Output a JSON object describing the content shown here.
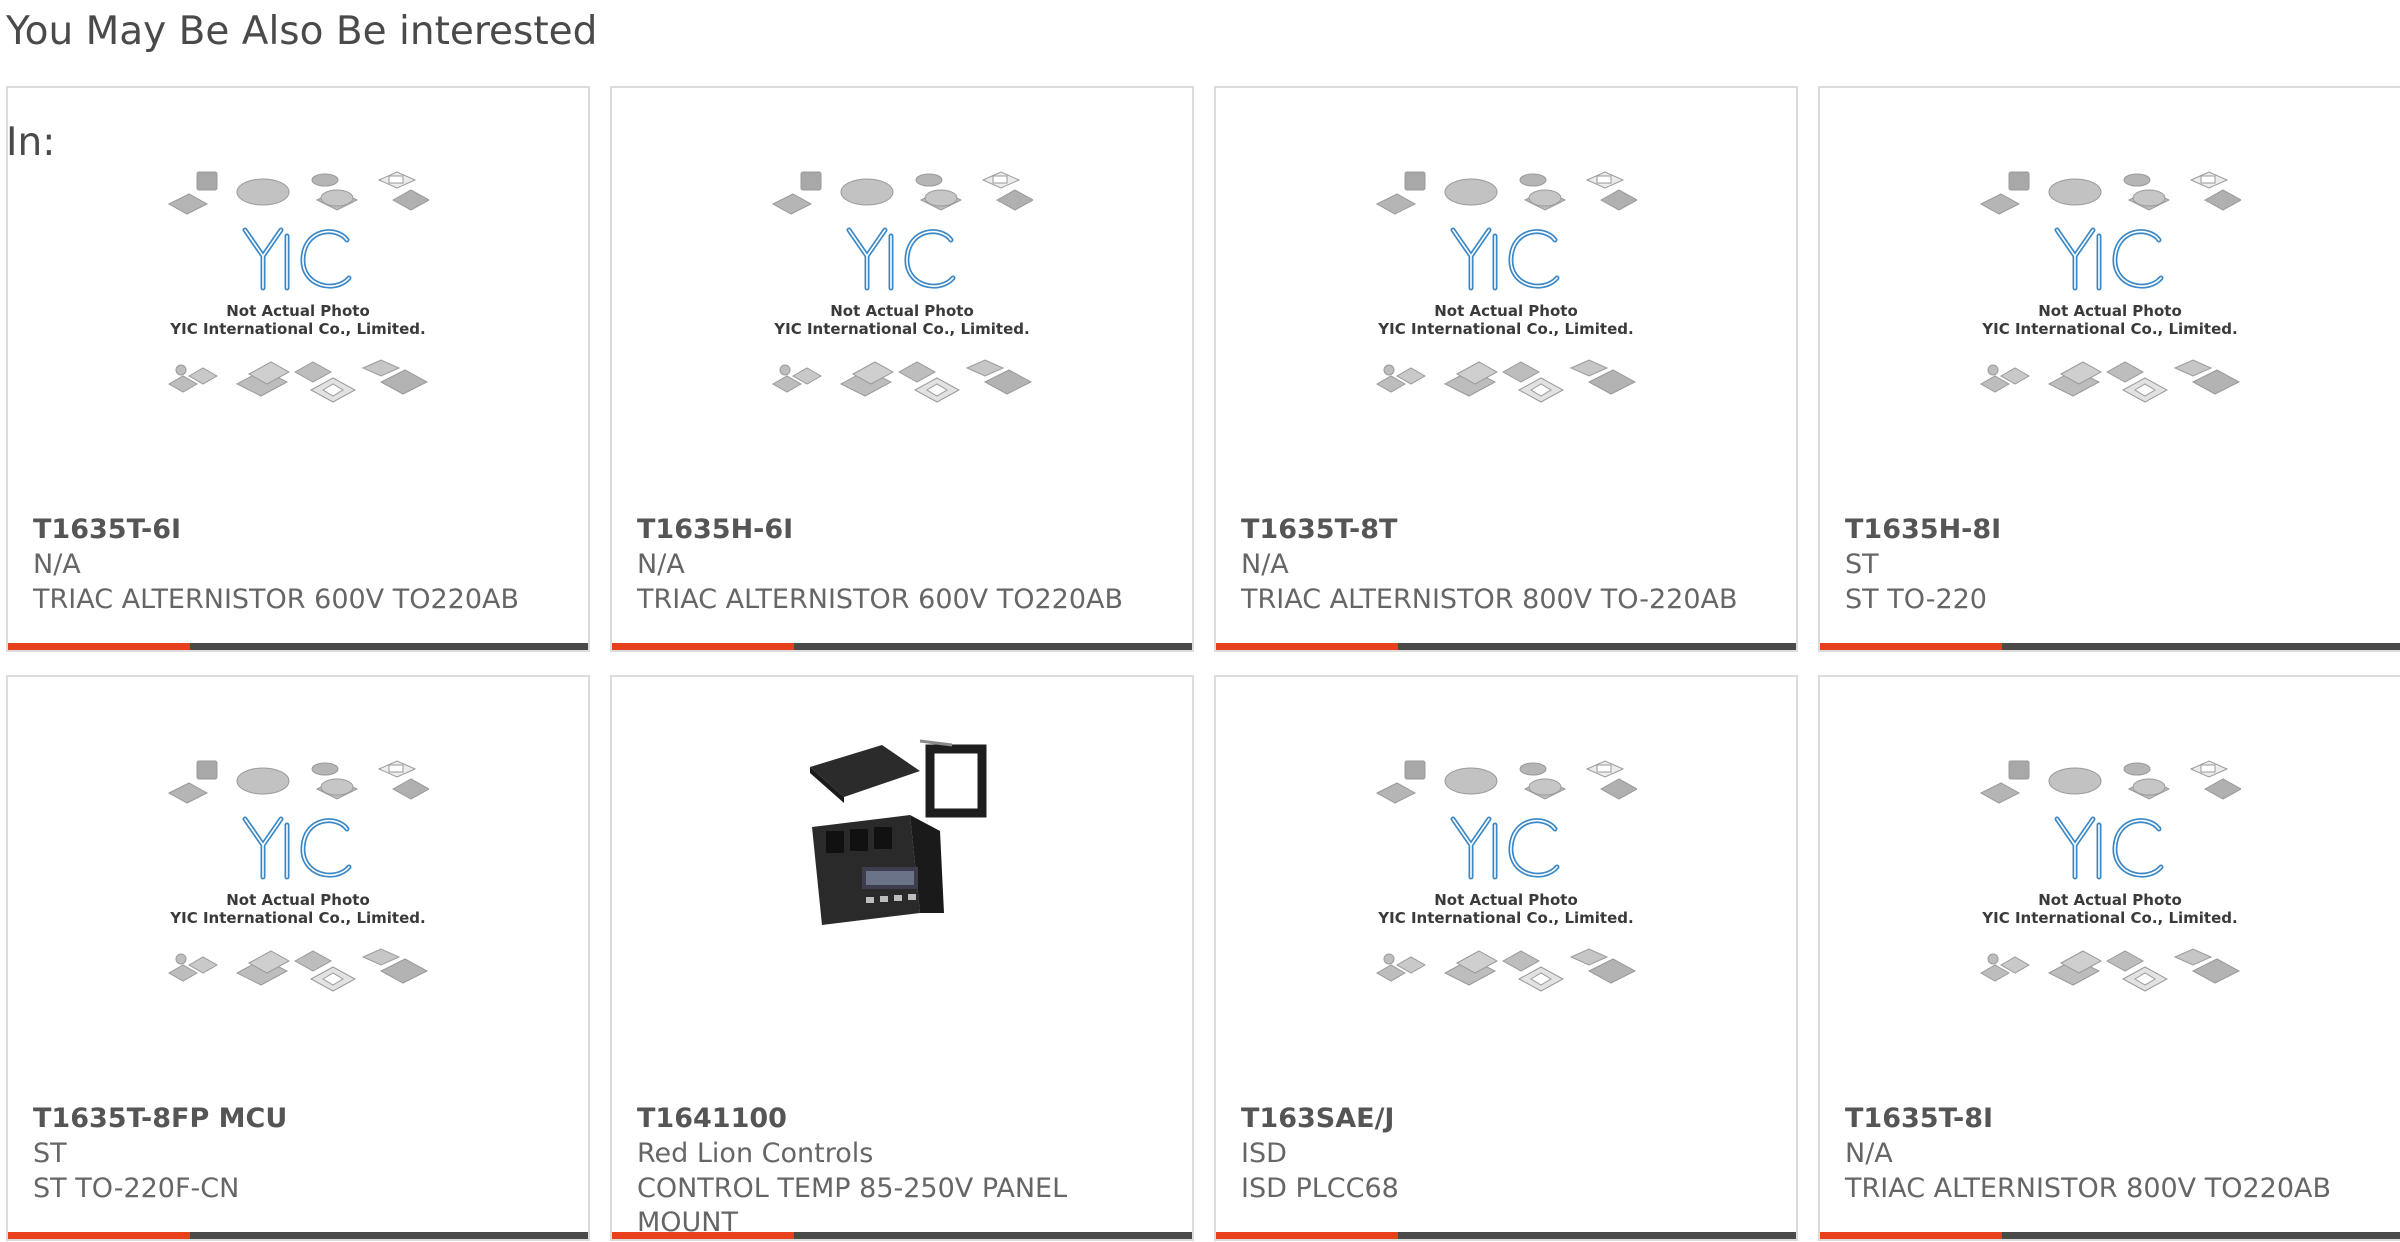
{
  "section": {
    "heading_line1": "You May Be Also Be interested",
    "heading_line2": "In:"
  },
  "theme": {
    "accent": "#e8401c",
    "bar": "#4a4a4a",
    "border": "#dcdcdc"
  },
  "placeholder_image": {
    "line1": "Not Actual Photo",
    "line2": "YIC International Co., Limited.",
    "logo_text": "YIC"
  },
  "products": [
    {
      "part_number": "T1635T-6I",
      "manufacturer": "N/A",
      "description": "TRIAC ALTERNISTOR 600V TO220AB",
      "image": "yic-placeholder"
    },
    {
      "part_number": "T1635H-6I",
      "manufacturer": "N/A",
      "description": "TRIAC ALTERNISTOR 600V TO220AB",
      "image": "yic-placeholder"
    },
    {
      "part_number": "T1635T-8T",
      "manufacturer": "N/A",
      "description": "TRIAC ALTERNISTOR 800V TO-220AB",
      "image": "yic-placeholder"
    },
    {
      "part_number": "T1635H-8I",
      "manufacturer": "ST",
      "description": "ST TO-220",
      "image": "yic-placeholder"
    },
    {
      "part_number": "T1635T-8FP MCU",
      "manufacturer": "ST",
      "description": "ST TO-220F-CN",
      "image": "yic-placeholder"
    },
    {
      "part_number": "T1641100",
      "manufacturer": "Red Lion Controls",
      "description": "CONTROL TEMP 85-250V PANEL MOUNT",
      "image": "panel-controller-photo"
    },
    {
      "part_number": "T163SAE/J",
      "manufacturer": "ISD",
      "description": "ISD PLCC68",
      "image": "yic-placeholder"
    },
    {
      "part_number": "T1635T-8I",
      "manufacturer": "N/A",
      "description": "TRIAC ALTERNISTOR 800V TO220AB",
      "image": "yic-placeholder"
    }
  ]
}
